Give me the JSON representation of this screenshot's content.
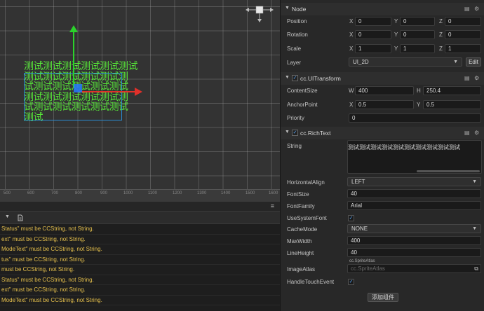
{
  "scene": {
    "ruler_ticks": [
      "500",
      "600",
      "700",
      "800",
      "900",
      "1000",
      "1100",
      "1200",
      "1300",
      "1400",
      "1500",
      "1600"
    ],
    "richtext_lines": [
      "测试测试测试测试测试测试",
      "测试测试测试测试测试测",
      "试测试测试测试测试测试",
      "测试测试测试测试测试测",
      "试测试测试测试测试测试",
      "测试"
    ],
    "colors": {
      "text": "#57e838",
      "axis_y": "#2bd22b",
      "axis_x": "#e0302a",
      "selection": "#2a8cd4",
      "anchor": "#2678ff"
    }
  },
  "console": {
    "menu_icon": "≡",
    "toolbar_icons": [
      "chevron-down-icon",
      "file-icon"
    ],
    "lines": [
      "Status\" must be CCString, not String.",
      "ext\" must be CCString, not String.",
      "ModeText\" must be CCString, not String.",
      "tus\" must be CCString, not String.",
      "must be CCString, not String.",
      "Status\" must be CCString, not String.",
      "ext\" must be CCString, not String.",
      "ModeText\" must be CCString, not String."
    ]
  },
  "inspector": {
    "node": {
      "title": "Node",
      "position": {
        "label": "Position",
        "x": "0",
        "y": "0",
        "z": "0"
      },
      "rotation": {
        "label": "Rotation",
        "x": "0",
        "y": "0",
        "z": "0"
      },
      "scale": {
        "label": "Scale",
        "x": "1",
        "y": "1",
        "z": "1"
      },
      "layer": {
        "label": "Layer",
        "value": "UI_2D",
        "edit": "Edit"
      }
    },
    "ui_transform": {
      "title": "cc.UITransform",
      "content_size": {
        "label": "ContentSize",
        "w_label": "W",
        "w": "400",
        "h_label": "H",
        "h": "250.4"
      },
      "anchor_point": {
        "label": "AnchorPoint",
        "x": "0.5",
        "y": "0.5"
      },
      "priority": {
        "label": "Priority",
        "value": "0"
      }
    },
    "rich_text": {
      "title": "cc.RichText",
      "string": {
        "label": "String",
        "value": "测试测试测试测试测试测试测试测试测试测试"
      },
      "horizontal_align": {
        "label": "HorizontalAlign",
        "value": "LEFT"
      },
      "font_size": {
        "label": "FontSize",
        "value": "40"
      },
      "font_family": {
        "label": "FontFamily",
        "value": "Arial"
      },
      "use_system_font": {
        "label": "UseSystemFont",
        "checked": true
      },
      "cache_mode": {
        "label": "CacheMode",
        "value": "NONE"
      },
      "max_width": {
        "label": "MaxWidth",
        "value": "400"
      },
      "line_height": {
        "label": "LineHeight",
        "value": "40"
      },
      "image_atlas": {
        "label": "ImageAtlas",
        "type_tag": "cc.SpriteAtlas",
        "placeholder": "cc.SpriteAtlas"
      },
      "handle_touch_event": {
        "label": "HandleTouchEvent",
        "checked": true
      }
    },
    "add_component": "添加组件",
    "axis": {
      "x": "X",
      "y": "Y",
      "z": "Z"
    }
  }
}
